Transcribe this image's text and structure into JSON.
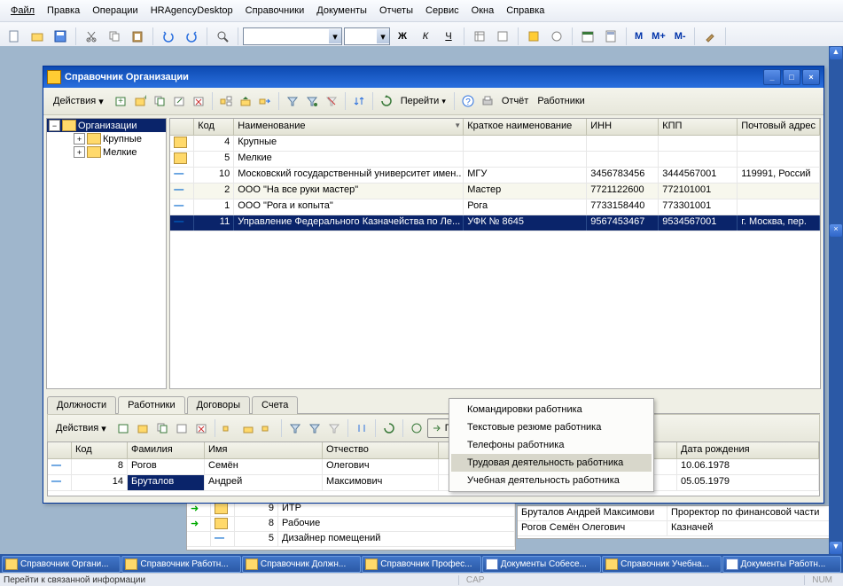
{
  "menubar": [
    "Файл",
    "Правка",
    "Операции",
    "HRAgencyDesktop",
    "Справочники",
    "Документы",
    "Отчеты",
    "Сервис",
    "Окна",
    "Справка"
  ],
  "window": {
    "title": "Справочник Организации",
    "actions_label": "Действия",
    "goto_label": "Перейти",
    "report_label": "Отчёт",
    "workers_label": "Работники"
  },
  "tree": {
    "root": "Организации",
    "children": [
      "Крупные",
      "Мелкие"
    ]
  },
  "grid": {
    "headers": [
      "",
      "Код",
      "Наименование",
      "Краткое наименование",
      "ИНН",
      "КПП",
      "Почтовый адрес"
    ],
    "rows": [
      {
        "t": "f",
        "code": "4",
        "name": "Крупные",
        "short": "",
        "inn": "",
        "kpp": "",
        "addr": ""
      },
      {
        "t": "f",
        "code": "5",
        "name": "Мелкие",
        "short": "",
        "inn": "",
        "kpp": "",
        "addr": ""
      },
      {
        "t": "i",
        "code": "10",
        "name": "Московский государственный университет имен..",
        "short": "МГУ",
        "inn": "3456783456",
        "kpp": "3444567001",
        "addr": "119991, Россий"
      },
      {
        "t": "i",
        "code": "2",
        "name": "ООО \"На все руки мастер\"",
        "short": "Мастер",
        "inn": "7721122600",
        "kpp": "772101001",
        "addr": ""
      },
      {
        "t": "i",
        "code": "1",
        "name": "ООО \"Рога и копыта\"",
        "short": "Рога",
        "inn": "7733158440",
        "kpp": "773301001",
        "addr": ""
      },
      {
        "t": "i",
        "code": "11",
        "name": "Управление Федерального Казначейства по Ле...",
        "short": "УФК № 8645",
        "inn": "9567453467",
        "kpp": "9534567001",
        "addr": "г. Москва, пер.",
        "sel": true
      }
    ]
  },
  "tabs": [
    "Должности",
    "Работники",
    "Договоры",
    "Счета"
  ],
  "activeTab": 1,
  "detail_toolbar": {
    "actions": "Действия",
    "goto": "Перейти"
  },
  "detail_grid": {
    "headers": [
      "",
      "Код",
      "Фамилия",
      "Имя",
      "Отчество",
      "",
      "Дата рождения"
    ],
    "rows": [
      {
        "code": "8",
        "f": "Рогов",
        "i": "Семён",
        "o": "Олегович",
        "d": "10.06.1978"
      },
      {
        "code": "14",
        "f": "Бруталов",
        "i": "Андрей",
        "o": "Максимович",
        "d": "05.05.1979",
        "sel": true
      }
    ]
  },
  "popup": {
    "items": [
      "Командировки работника",
      "Текстовые резюме работника",
      "Телефоны работника",
      "Трудовая деятельность работника",
      "Учебная деятельность работника"
    ],
    "highlight": 3
  },
  "bg_left": {
    "rows": [
      {
        "code": "9",
        "name": "ИТР",
        "arrow": true
      },
      {
        "code": "8",
        "name": "Рабочие",
        "arrow": true
      },
      {
        "code": "5",
        "name": "Дизайнер помещений"
      }
    ]
  },
  "bg_right": {
    "rows": [
      {
        "a": "Бруталов Андрей Максимови",
        "b": "Проректор по финансовой части"
      },
      {
        "a": "Рогов Семён Олегович",
        "b": "Казначей"
      }
    ]
  },
  "taskbar": [
    {
      "t": "Справочник Органи...",
      "type": "ref"
    },
    {
      "t": "Справочник Работн...",
      "type": "ref"
    },
    {
      "t": "Справочник Должн...",
      "type": "ref"
    },
    {
      "t": "Справочник Профес...",
      "type": "ref"
    },
    {
      "t": "Документы Собесе...",
      "type": "doc"
    },
    {
      "t": "Справочник Учебна...",
      "type": "ref"
    },
    {
      "t": "Документы Работн...",
      "type": "doc"
    }
  ],
  "statusbar": {
    "text": "Перейти к связанной информации",
    "cap": "CAP",
    "num": "NUM"
  },
  "m_buttons": [
    "M",
    "M+",
    "M-"
  ]
}
